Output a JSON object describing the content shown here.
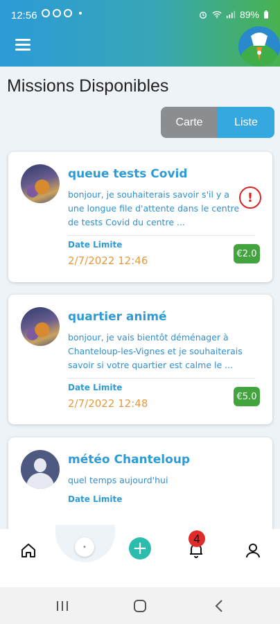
{
  "status_bar": {
    "time": "12:56",
    "battery": "89%"
  },
  "header": {
    "menu_icon": "hamburger-menu-icon",
    "logo_icon": "app-logo"
  },
  "page": {
    "title": "Missions Disponibles"
  },
  "view_toggle": {
    "options": [
      "Carte",
      "Liste"
    ],
    "selected": "Liste"
  },
  "missions": [
    {
      "title": "queue tests Covid",
      "description": "bonjour, je souhaiterais savoir s'il y a une longue file d'attente dans le centre de tests Covid du centre ...",
      "date_label": "Date Limite",
      "date": "2/7/2022 12:46",
      "price": "€2.0",
      "alert": "!"
    },
    {
      "title": "quartier animé",
      "description": "bonjour, je vais bientôt déménager à Chanteloup-les-Vignes et je souhaiterais savoir si votre quartier est calme le ...",
      "date_label": "Date Limite",
      "date": "2/7/2022 12:48",
      "price": "€5.0"
    },
    {
      "title": "météo Chanteloup",
      "description": "quel temps aujourd'hui",
      "date_label": "Date Limite"
    }
  ],
  "bottom_nav": {
    "notification_count": "4",
    "center_dot": "•",
    "add_symbol": "+"
  },
  "colors": {
    "accent_blue": "#2c9bd8",
    "date_orange": "#e59a3e",
    "price_green": "#43a43f",
    "alert_red": "#dd2222",
    "add_teal": "#2bbcad"
  }
}
